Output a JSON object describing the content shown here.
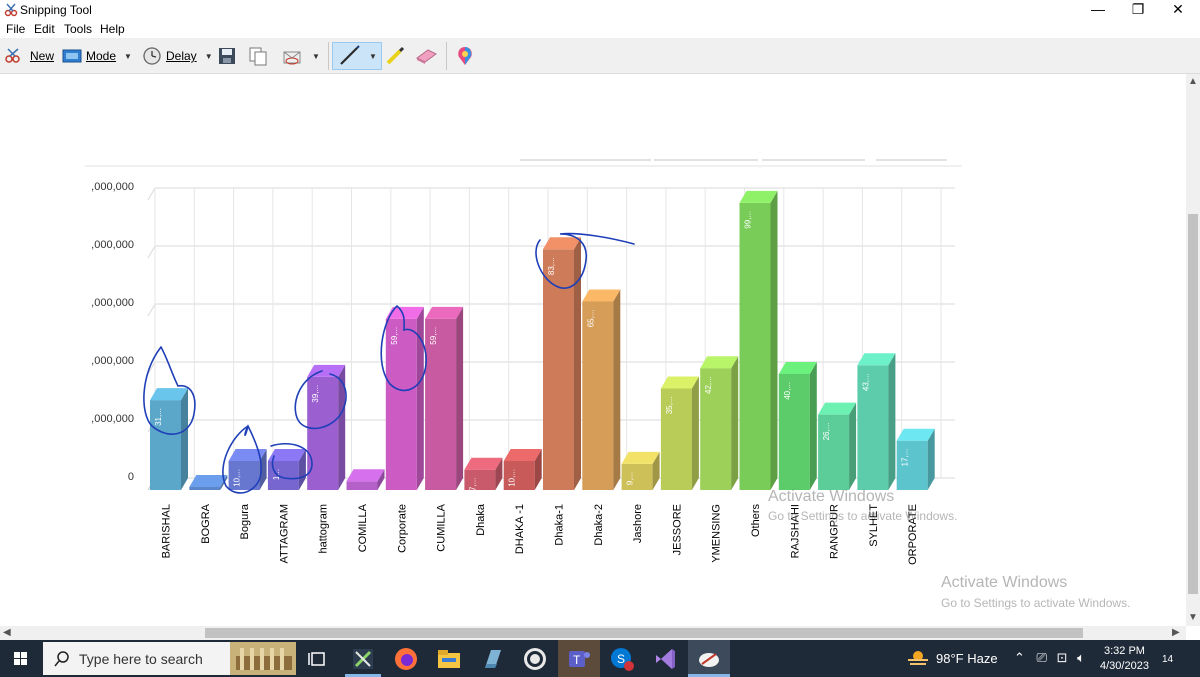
{
  "window": {
    "title": "Snipping Tool",
    "controls": [
      "—",
      "❐",
      "✕"
    ]
  },
  "menu": [
    "File",
    "Edit",
    "Tools",
    "Help"
  ],
  "toolbar": {
    "new_label": "New",
    "mode_label": "Mode",
    "delay_label": "Delay"
  },
  "chart_data": {
    "type": "bar",
    "title": "",
    "xlabel": "",
    "ylabel": "",
    "ylim": [
      0,
      100000000
    ],
    "yticks": [
      "0",
      ",000,000",
      ",000,000",
      ",000,000",
      ",000,000",
      ",000,000"
    ],
    "categories": [
      "BARISHAL",
      "BOGRA",
      "Bogura",
      "ATTAGRAM",
      "hattogram",
      "COMILLA",
      "Corporate",
      "CUMILLA",
      "Dhaka",
      "DHAKA -1",
      "Dhaka-1",
      "Dhaka-2",
      "Jashore",
      "JESSORE",
      "YMENSING",
      "Others",
      "RAJSHAHI",
      "RANGPUR",
      "SYLHET",
      "ORPORATE"
    ],
    "values": [
      31000000,
      1000000,
      10000000,
      10000000,
      39000000,
      3000000,
      59000000,
      59000000,
      7000000,
      10000000,
      83000000,
      65000000,
      9000000,
      35000000,
      42000000,
      99000000,
      40000000,
      26000000,
      43000000,
      17000000
    ],
    "data_labels": [
      "31,...",
      "",
      "10,...",
      "1...",
      "39,...",
      "",
      "59,...",
      "59,...",
      "7,...",
      "10,...",
      "83,...",
      "65,...",
      "9,...",
      "35,...",
      "42,...",
      "99,...",
      "40,...",
      "26,...",
      "43,...",
      "17,..."
    ],
    "colors": [
      "#5aa7c9",
      "#5b86c9",
      "#6777cf",
      "#7766d0",
      "#9b5fd0",
      "#b55fc9",
      "#cc5cc4",
      "#c75aa0",
      "#c95a6c",
      "#c95a5a",
      "#cd7b58",
      "#d59d58",
      "#cdc058",
      "#b9cc58",
      "#9cd058",
      "#79cc58",
      "#5ccc6a",
      "#5ccc98",
      "#5cccaa",
      "#5cc4cc"
    ]
  },
  "watermark": {
    "line1": "Activate Windows",
    "line2": "Go to Settings to activate Windows."
  },
  "taskbar": {
    "search_placeholder": "Type here to search",
    "weather": "98°F  Haze",
    "time": "3:32 PM",
    "date": "4/30/2023",
    "notifications": "14"
  }
}
